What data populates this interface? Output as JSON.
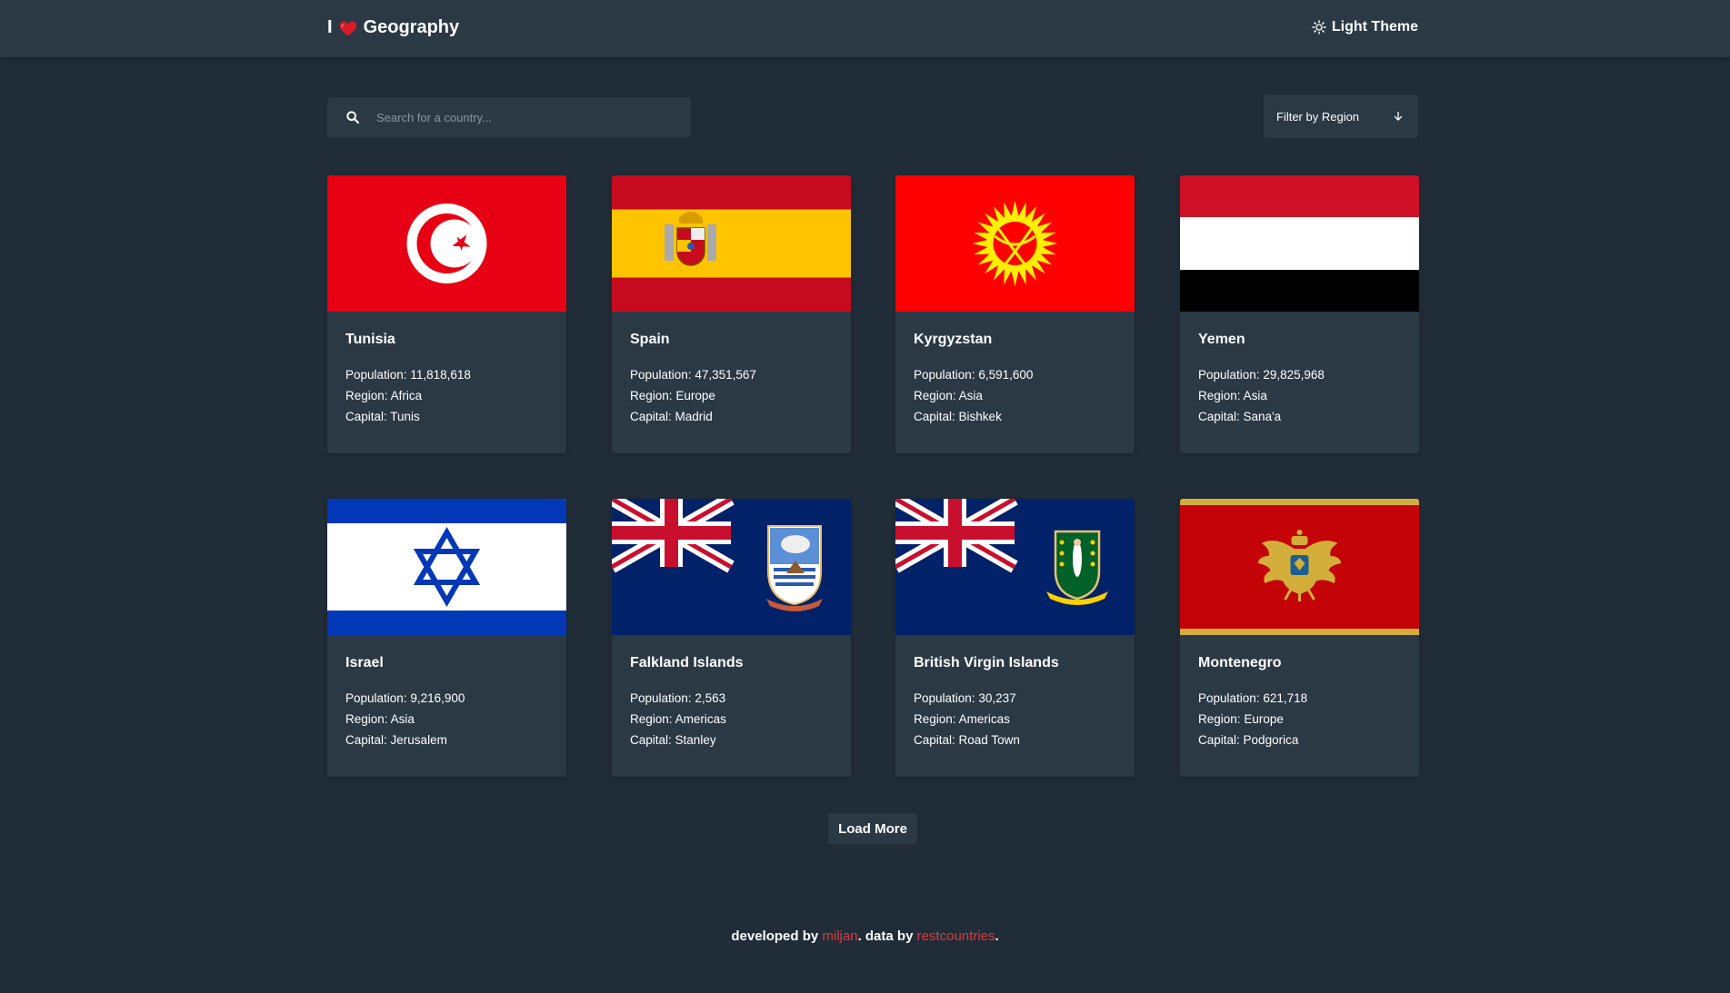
{
  "header": {
    "logo_prefix": "I",
    "logo_title": "Geography",
    "theme_label": "Light Theme"
  },
  "search": {
    "placeholder": "Search for a country..."
  },
  "filter": {
    "label": "Filter by Region"
  },
  "labels": {
    "population": "Population:",
    "region": "Region:",
    "capital": "Capital:"
  },
  "countries": [
    {
      "name": "Tunisia",
      "population": "11,818,618",
      "region": "Africa",
      "capital": "Tunis",
      "flag": "tunisia-flag"
    },
    {
      "name": "Spain",
      "population": "47,351,567",
      "region": "Europe",
      "capital": "Madrid",
      "flag": "spain-flag"
    },
    {
      "name": "Kyrgyzstan",
      "population": "6,591,600",
      "region": "Asia",
      "capital": "Bishkek",
      "flag": "kyrgyzstan-flag"
    },
    {
      "name": "Yemen",
      "population": "29,825,968",
      "region": "Asia",
      "capital": "Sana'a",
      "flag": "yemen-flag"
    },
    {
      "name": "Israel",
      "population": "9,216,900",
      "region": "Asia",
      "capital": "Jerusalem",
      "flag": "israel-flag"
    },
    {
      "name": "Falkland Islands",
      "population": "2,563",
      "region": "Americas",
      "capital": "Stanley",
      "flag": "falkland-islands-flag"
    },
    {
      "name": "British Virgin Islands",
      "population": "30,237",
      "region": "Americas",
      "capital": "Road Town",
      "flag": "british-virgin-islands-flag"
    },
    {
      "name": "Montenegro",
      "population": "621,718",
      "region": "Europe",
      "capital": "Podgorica",
      "flag": "montenegro-flag"
    }
  ],
  "load_more_label": "Load More",
  "footer": {
    "developed_by": "developed by",
    "author": "miljan",
    "data_by": ". data by",
    "source": "restcountries",
    "end": "."
  },
  "colors": {
    "background": "#202c37",
    "surface": "#2b3945",
    "text": "#ffffff",
    "link": "#e0393e"
  }
}
